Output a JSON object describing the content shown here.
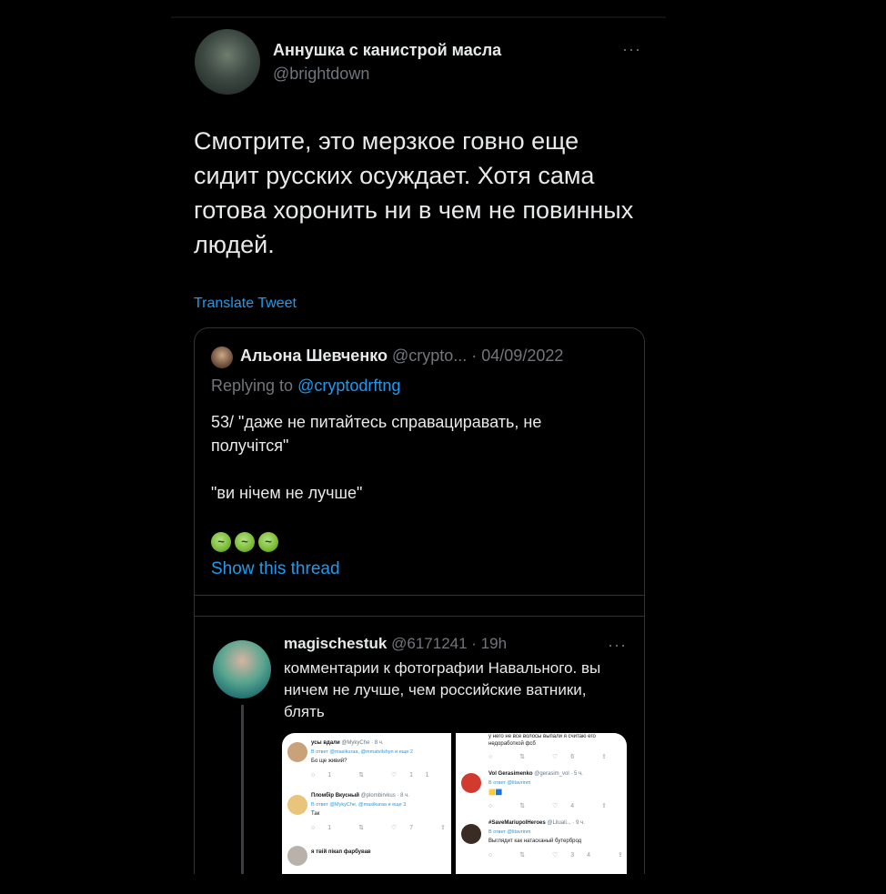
{
  "tweet": {
    "author_name": "Аннушка с канистрой масла",
    "author_handle": "@brightdown",
    "more_icon": "···",
    "text": "Смотрите, это мерзкое говно еще сидит русских осуждает. Хотя сама готова хоронить ни в чем не повинных людей.",
    "translate_label": "Translate Tweet"
  },
  "quote": {
    "name": "Альона Шевченко",
    "meta": "@crypto... · 04/09/2022",
    "replying_prefix": "Replying to ",
    "replying_handle": "@cryptodrftng",
    "text": "53/ \"даже не питайтесь справациравать, не получітся\"\n\n \"ви нічем не лучше\"",
    "emojis": [
      "nauseated-face",
      "nauseated-face",
      "nauseated-face"
    ],
    "show_thread": "Show this thread"
  },
  "reply": {
    "name": "magischestuk",
    "meta": "@6171241 · 19h",
    "more_icon": "···",
    "text": "комментарии к фотографии Навального. вы ничем не лучше, чем российские ватники, блять"
  },
  "screenshots": {
    "left": [
      {
        "name": "усы вдали",
        "meta": "@MykyChe · 8 ч.",
        "sub": "В ответ @masikuraa, @mmatvilshyn и еще 2",
        "text": "Бо ще живий?",
        "icons": "○1 ⇅ ♡11 ⇪"
      },
      {
        "name": "Пломбір Вкусный",
        "meta": "@plombirvkus · 8 ч.",
        "sub": "В ответ @MykyChe, @masikuraa и еще 3",
        "text": "Так",
        "icons": "○1 ⇅ ♡7 ⇪"
      },
      {
        "name": "я твій пікап фарбував",
        "meta": "",
        "sub": "",
        "text": "",
        "icons": ""
      }
    ],
    "right": [
      {
        "name": "",
        "meta": "",
        "sub": "",
        "text": "у него не все волосы выпали я считаю его недоработкой фсб",
        "icons": "○ ⇅ ♡6 ⇪"
      },
      {
        "name": "Vol Gerasimenko",
        "meta": "@gerasim_vol · 5 ч.",
        "sub": "В ответ @litavrinm",
        "text": "",
        "icons": "○ ⇅ ♡4 ⇪"
      },
      {
        "name": "#SaveMariupolHeroes",
        "meta": "@Liluali... · 9 ч.",
        "sub": "В ответ @litavrinm",
        "text": "Выглядит как натасканый бутерброд",
        "icons": "○ ⇅ ♡34 ⇪"
      }
    ]
  },
  "colors": {
    "background": "#000000",
    "text": "#e7e9ea",
    "secondary": "#71767b",
    "link": "#1d9bf0",
    "border": "#2f3336"
  }
}
